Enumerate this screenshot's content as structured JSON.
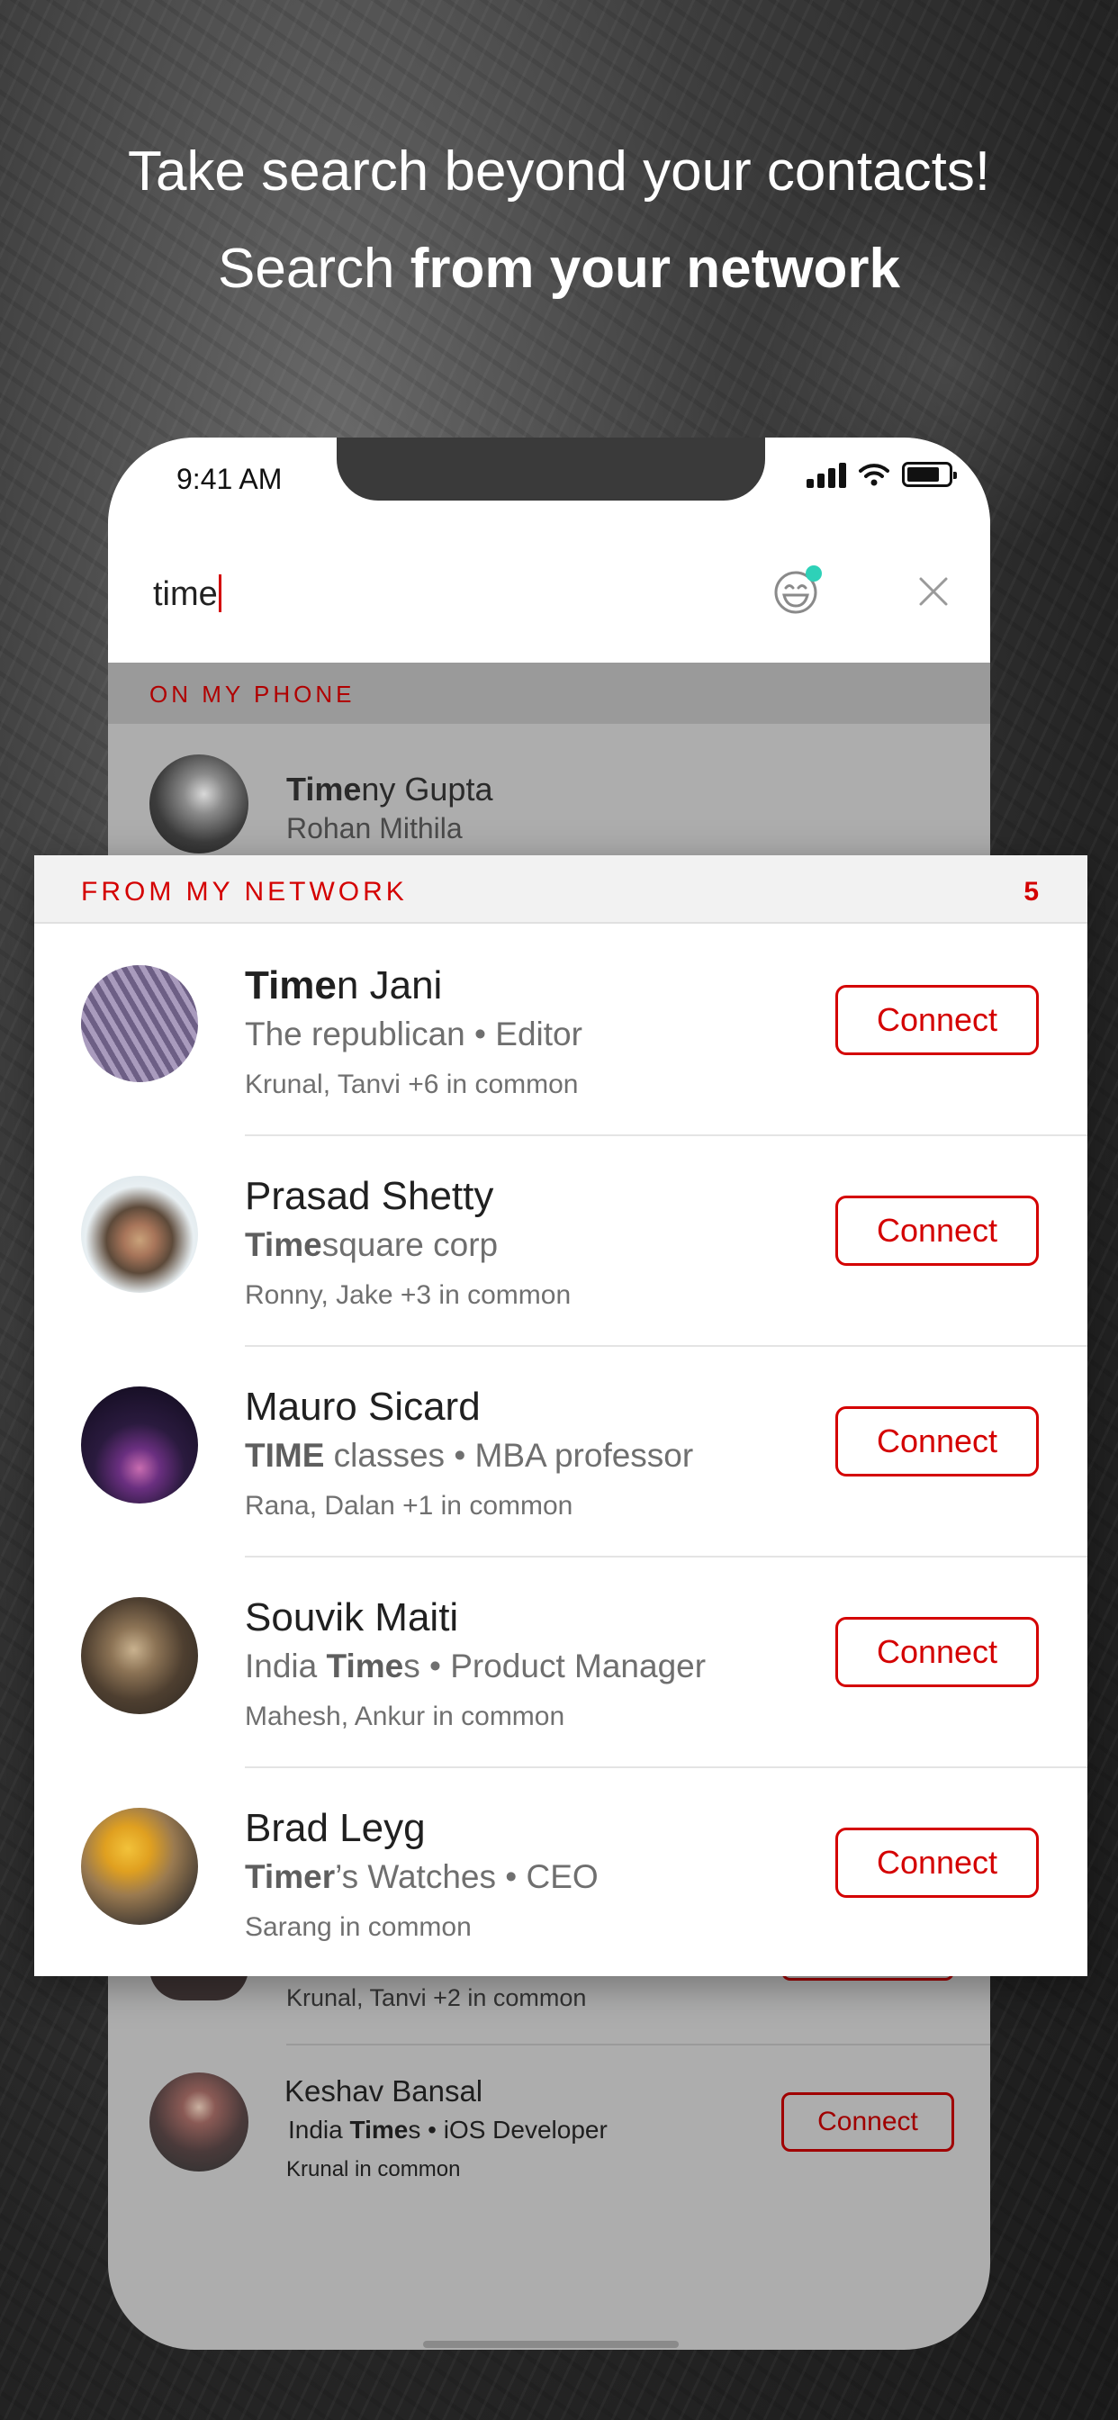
{
  "promo": {
    "line1": "Take search beyond your contacts!",
    "line2_prefix": "Search ",
    "line2_bold": "from your network"
  },
  "status_bar": {
    "time": "9:41 AM"
  },
  "search": {
    "query": "time"
  },
  "on_my_phone": {
    "label": "ON MY PHONE",
    "contact": {
      "name_match": "Time",
      "name_rest": "ny Gupta",
      "subtitle": "Rohan Mithila"
    }
  },
  "network": {
    "label": "FROM MY NETWORK",
    "count": "5",
    "items": [
      {
        "name_match": "Time",
        "name_rest": "n Jani",
        "sub_pre": "",
        "sub_match": "",
        "sub_rest": "The republican • Editor",
        "common": "Krunal, Tanvi +6 in common",
        "button": "Connect"
      },
      {
        "name_match": "",
        "name_rest": "Prasad Shetty",
        "sub_pre": "",
        "sub_match": "Time",
        "sub_rest": "square corp",
        "common": "Ronny, Jake +3 in common",
        "button": "Connect"
      },
      {
        "name_match": "",
        "name_rest": "Mauro Sicard",
        "sub_pre": "",
        "sub_match": "TIME",
        "sub_rest": " classes • MBA professor",
        "common": "Rana, Dalan +1 in common",
        "button": "Connect"
      },
      {
        "name_match": "",
        "name_rest": "Souvik Maiti",
        "sub_pre": "India ",
        "sub_match": "Time",
        "sub_rest": "s • Product Manager",
        "common": "Mahesh, Ankur in common",
        "button": "Connect"
      },
      {
        "name_match": "",
        "name_rest": "Brad Leyg",
        "sub_pre": "",
        "sub_match": "Timer",
        "sub_rest": "’s Watches • CEO",
        "common": "Sarang in common",
        "button": "Connect"
      }
    ]
  },
  "underlying": {
    "partial_common": "Krunal, Tanvi +2 in common",
    "keshav": {
      "name": "Keshav Bansal",
      "sub_pre": "India ",
      "sub_match": "Time",
      "sub_rest": "s • iOS Developer",
      "common": "Krunal in common",
      "button": "Connect"
    }
  },
  "colors": {
    "accent": "#d40000",
    "phone_dim": "#adadad"
  }
}
